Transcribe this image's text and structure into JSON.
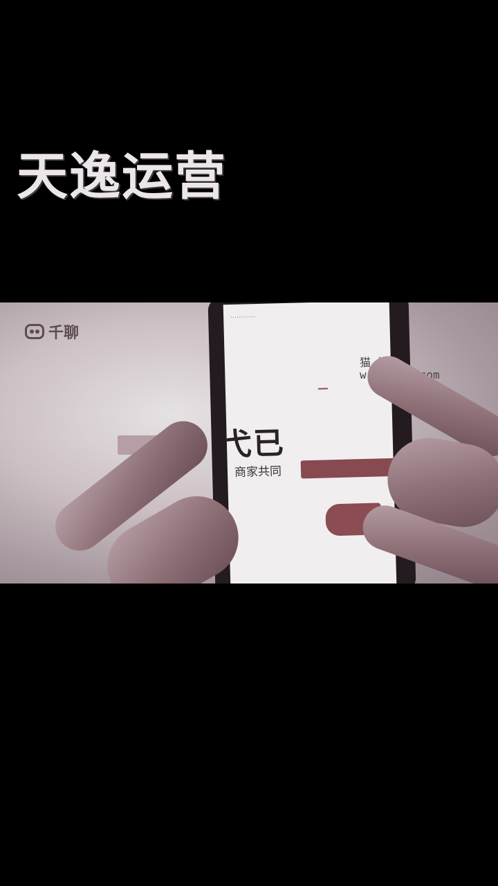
{
  "overlay_title": "天逸运营",
  "left_screen": {
    "logo_text": "千聊"
  },
  "phone_screen": {
    "notification": "…………",
    "top_label": "",
    "tab_label": "",
    "big_text": "弋已",
    "sub_text": "商家共同",
    "button_label": "",
    "footer_url": ""
  },
  "watermark": {
    "line1": "猫   坛",
    "line2": "w       owotao.com"
  },
  "colors": {
    "background": "#000000",
    "accent_red": "#864a50",
    "title_text": "#ece6ea"
  }
}
